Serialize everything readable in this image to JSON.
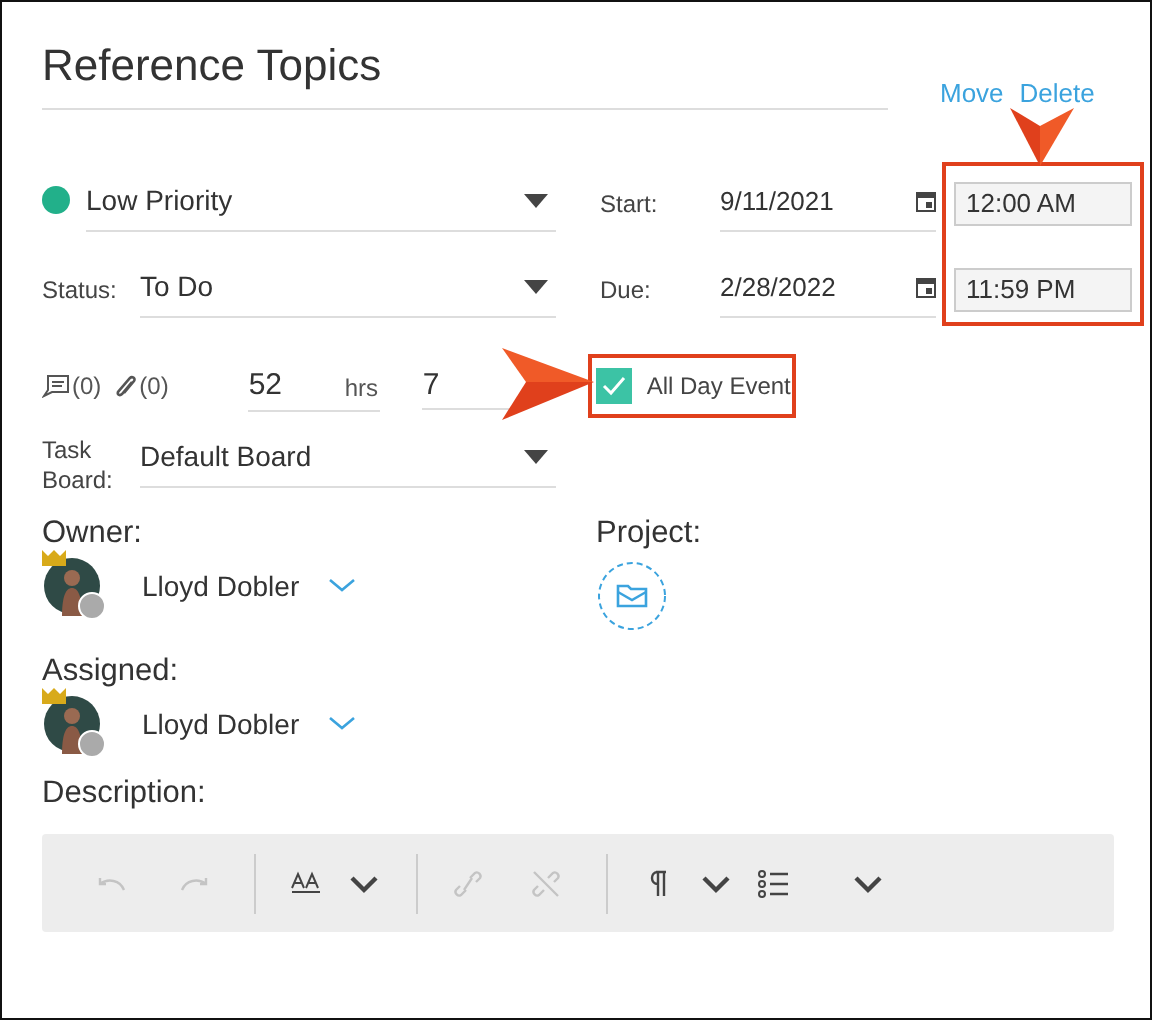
{
  "title": "Reference Topics",
  "actions": [
    {
      "label": "Move"
    },
    {
      "label": "Delete"
    }
  ],
  "priority": {
    "value": "Low Priority",
    "color": "#22b08a"
  },
  "start": {
    "label": "Start:",
    "date": "9/11/2021",
    "time": "12:00 AM"
  },
  "status": {
    "label": "Status:",
    "value": "To Do"
  },
  "due": {
    "label": "Due:",
    "date": "2/28/2022",
    "time": "11:59 PM"
  },
  "counts": {
    "notes": "(0)",
    "attachments": "(0)"
  },
  "duration": {
    "hours": "52",
    "hrs_label": "hrs",
    "minutes": "7"
  },
  "all_day": {
    "label": "All Day Event",
    "checked": true
  },
  "task_board": {
    "label": "Task Board:",
    "value": "Default Board"
  },
  "owner": {
    "label": "Owner:",
    "name": "Lloyd Dobler"
  },
  "project": {
    "label": "Project:"
  },
  "assigned": {
    "label": "Assigned:",
    "name": "Lloyd Dobler"
  },
  "description": {
    "label": "Description:"
  },
  "toolbar": [
    {
      "kind": "undo",
      "disabled": true
    },
    {
      "kind": "redo",
      "disabled": true
    },
    {
      "kind": "separator"
    },
    {
      "kind": "font-size",
      "disabled": false
    },
    {
      "kind": "dropdown",
      "disabled": false
    },
    {
      "kind": "separator"
    },
    {
      "kind": "link",
      "disabled": true
    },
    {
      "kind": "unlink",
      "disabled": true
    },
    {
      "kind": "separator"
    },
    {
      "kind": "paragraph",
      "disabled": false
    },
    {
      "kind": "dropdown",
      "disabled": false
    },
    {
      "kind": "list",
      "disabled": false
    },
    {
      "kind": "dropdown",
      "disabled": false
    }
  ]
}
